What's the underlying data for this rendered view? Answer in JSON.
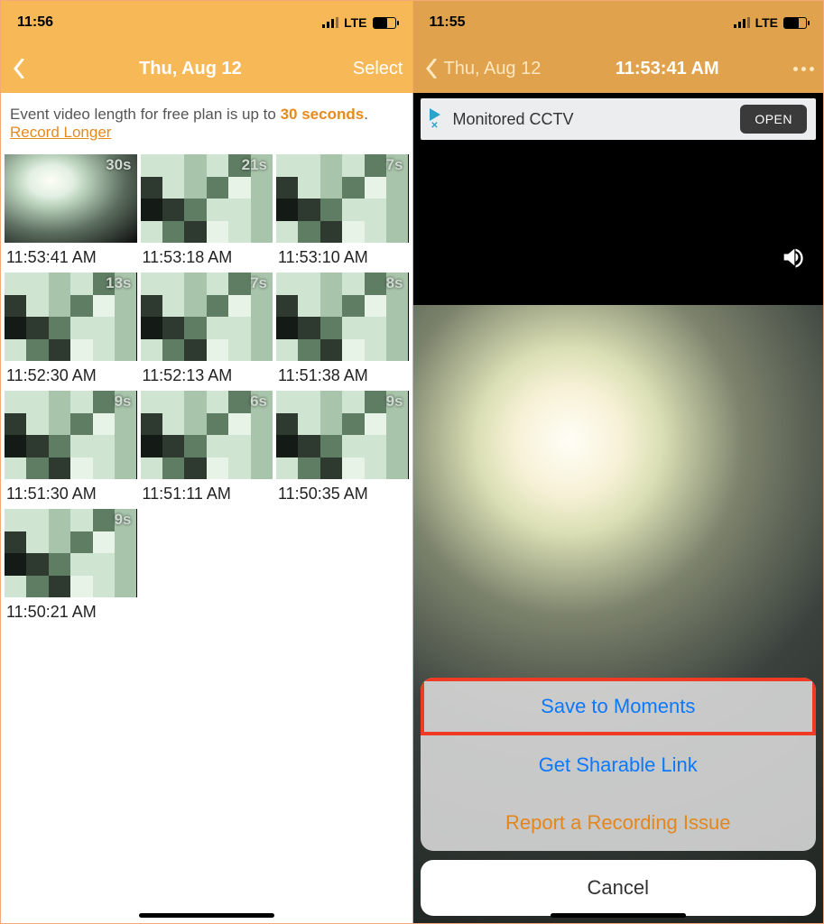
{
  "left": {
    "status": {
      "time": "11:56",
      "net": "LTE"
    },
    "nav": {
      "title": "Thu, Aug 12",
      "select": "Select"
    },
    "info": {
      "line1_pre": "Event video length for free plan is up to ",
      "line1_bold": "30 seconds",
      "line1_post": ".",
      "link": "Record Longer"
    },
    "clips": [
      {
        "dur": "30s",
        "time": "11:53:41 AM"
      },
      {
        "dur": "21s",
        "time": "11:53:18 AM"
      },
      {
        "dur": "7s",
        "time": "11:53:10 AM"
      },
      {
        "dur": "13s",
        "time": "11:52:30 AM"
      },
      {
        "dur": "7s",
        "time": "11:52:13 AM"
      },
      {
        "dur": "8s",
        "time": "11:51:38 AM"
      },
      {
        "dur": "9s",
        "time": "11:51:30 AM"
      },
      {
        "dur": "6s",
        "time": "11:51:11 AM"
      },
      {
        "dur": "9s",
        "time": "11:50:35 AM"
      },
      {
        "dur": "9s",
        "time": "11:50:21 AM"
      }
    ]
  },
  "right": {
    "status": {
      "time": "11:55",
      "net": "LTE"
    },
    "nav": {
      "back": "Thu, Aug 12",
      "time": "11:53:41 AM"
    },
    "ad": {
      "text": "Monitored CCTV",
      "cta": "OPEN"
    },
    "sheet": {
      "save": "Save to Moments",
      "share": "Get Sharable Link",
      "report": "Report a Recording Issue",
      "cancel": "Cancel"
    }
  }
}
